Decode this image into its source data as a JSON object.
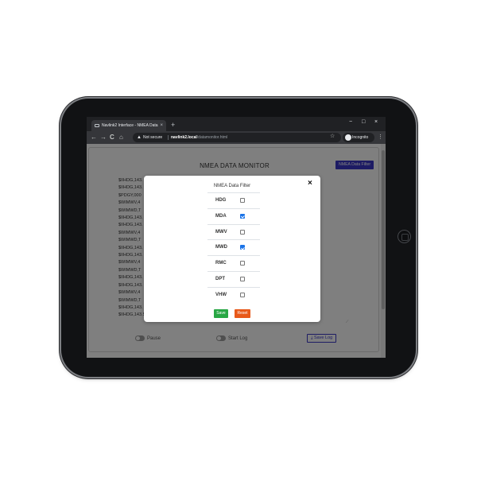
{
  "browser": {
    "tab_title": "Navlink2 Interface - NMEA Data",
    "tab_close": "×",
    "new_tab": "+",
    "window_controls": {
      "minimize": "−",
      "maximize": "□",
      "close": "×"
    },
    "nav": {
      "back": "←",
      "forward": "→",
      "reload": "C",
      "home": "⌂"
    },
    "security_warning": "Not secure",
    "url_host": "navlink2.local",
    "url_path": "/datamonitor.html",
    "star": "☆",
    "profile_label": "Incognito",
    "menu": "⋮"
  },
  "page": {
    "title": "NMEA DATA MONITOR",
    "filter_button": "NMEA Data Filter",
    "log_lines": [
      "$IIHDG,143.",
      "$IIHDG,143.",
      "$PDGY,000",
      "$WIMWV,4",
      "$WIMWD,T",
      "$IIHDG,143.",
      "$IIHDG,143.",
      "$WIMWV,4",
      "$WIMWD,T",
      "$IIHDG,143.",
      "$IIHDG,143.",
      "$WIMWV,4",
      "$WIMWD,T",
      "$IIHDG,143.",
      "$IIHDG,143.",
      "$WIMWV,4",
      "$WIMWD,T",
      "$IIHDG,143.",
      "$IIHDG,143.5,,,6.3,W*38"
    ],
    "pause_label": "Pause",
    "start_log_label": "Start Log",
    "save_log_label": "⤓ Save Log"
  },
  "modal": {
    "title": "NMEA Data Filter",
    "close": "×",
    "filters": [
      {
        "label": "HDG",
        "checked": false
      },
      {
        "label": "MDA",
        "checked": true
      },
      {
        "label": "MWV",
        "checked": false
      },
      {
        "label": "MWD",
        "checked": true
      },
      {
        "label": "RMC",
        "checked": false
      },
      {
        "label": "DPT",
        "checked": false
      },
      {
        "label": "VHW",
        "checked": false
      }
    ],
    "save_label": "Save",
    "reset_label": "Reset"
  },
  "colors": {
    "primary": "#3a37c9",
    "save": "#28a745",
    "reset": "#e8591a",
    "checkbox_checked": "#1a73e8"
  }
}
